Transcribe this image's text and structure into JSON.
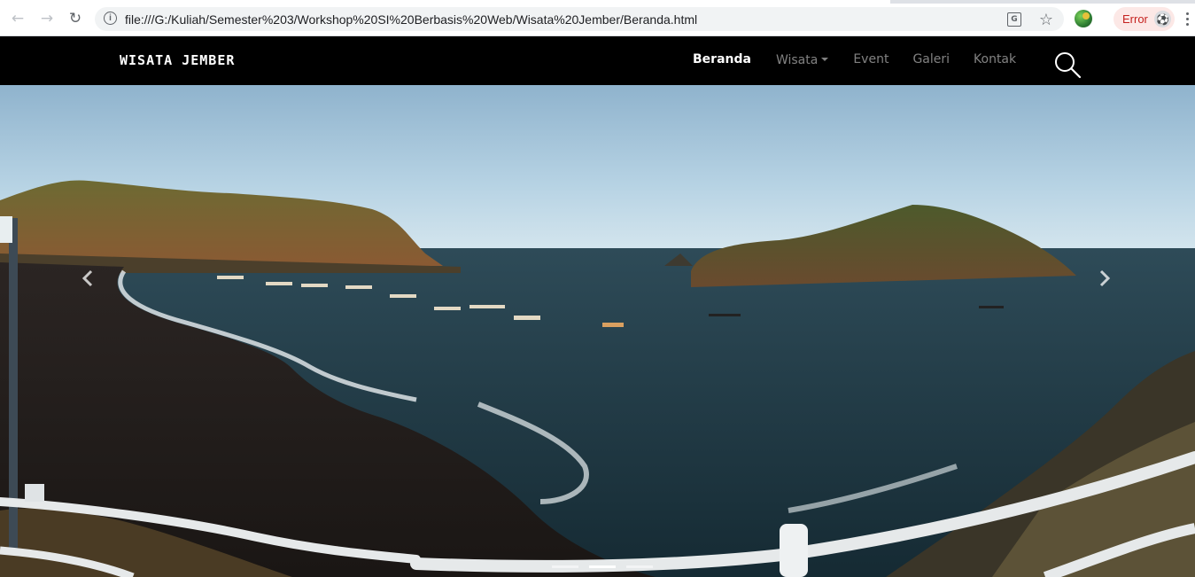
{
  "browser": {
    "url": "file:///G:/Kuliah/Semester%203/Workshop%20SI%20Berbasis%20Web/Wisata%20Jember/Beranda.html",
    "error_label": "Error",
    "icons": {
      "back": "arrow-left-icon",
      "forward": "arrow-right-icon",
      "reload": "reload-icon",
      "info": "info-icon",
      "translate": "translate-icon",
      "bookmark": "star-icon",
      "extension": "extension-icon",
      "menu": "kebab-menu-icon"
    }
  },
  "navbar": {
    "brand": "WISATA JEMBER",
    "links": [
      {
        "label": "Beranda",
        "active": true
      },
      {
        "label": "Wisata",
        "dropdown": true
      },
      {
        "label": "Event"
      },
      {
        "label": "Galeri"
      },
      {
        "label": "Kontak"
      }
    ],
    "search_icon": "search-icon"
  },
  "carousel": {
    "slides_total": 3,
    "active_slide": 2,
    "prev_icon": "chevron-left-icon",
    "next_icon": "chevron-right-icon"
  },
  "colors": {
    "navbar_bg": "#000000",
    "sea": "#233c47",
    "sky": "#a9c9de"
  }
}
